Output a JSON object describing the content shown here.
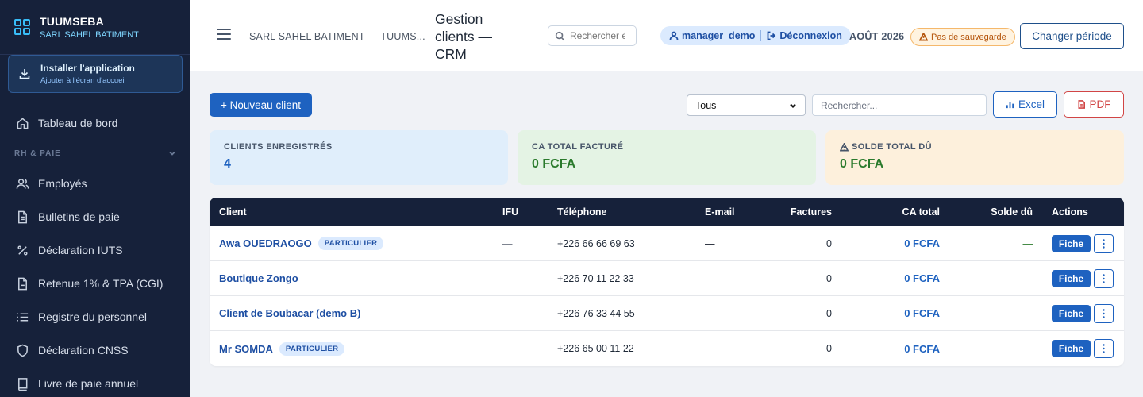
{
  "brand": {
    "name": "TUUMSEBA",
    "company": "SARL SAHEL BATIMENT"
  },
  "install": {
    "title": "Installer l'application",
    "subtitle": "Ajouter à l'écran d'accueil"
  },
  "sidebar": {
    "dashboard": "Tableau de bord",
    "section": "RH & PAIE",
    "items": [
      {
        "label": "Employés",
        "icon": "users-icon"
      },
      {
        "label": "Bulletins de paie",
        "icon": "document-icon"
      },
      {
        "label": "Déclaration IUTS",
        "icon": "percent-icon"
      },
      {
        "label": "Retenue 1% & TPA (CGI)",
        "icon": "file-icon"
      },
      {
        "label": "Registre du personnel",
        "icon": "list-icon"
      },
      {
        "label": "Déclaration CNSS",
        "icon": "shield-icon"
      },
      {
        "label": "Livre de paie annuel",
        "icon": "book-icon"
      }
    ]
  },
  "header": {
    "company": "SARL SAHEL BATIMENT — TUUMS...",
    "title": "Gestion clients — CRM",
    "search_placeholder": "Rechercher é",
    "user": "manager_demo",
    "logout": "Déconnexion",
    "period": "AOÛT 2026",
    "no_save": "Pas de sauvegarde",
    "change_period": "Changer période"
  },
  "toolbar": {
    "new_client": "+ Nouveau client",
    "filter_value": "Tous",
    "search_placeholder": "Rechercher...",
    "excel": "Excel",
    "pdf": "PDF"
  },
  "stats": {
    "clients": {
      "label": "CLIENTS ENREGISTRÉS",
      "value": "4"
    },
    "ca": {
      "label": "CA TOTAL FACTURÉ",
      "value": "0 FCFA"
    },
    "solde": {
      "label": "SOLDE TOTAL DÛ",
      "value": "0 FCFA"
    }
  },
  "table": {
    "headers": {
      "client": "Client",
      "ifu": "IFU",
      "tel": "Téléphone",
      "mail": "E-mail",
      "factures": "Factures",
      "ca": "CA total",
      "solde": "Solde dû",
      "actions": "Actions"
    },
    "fiche_label": "Fiche",
    "rows": [
      {
        "name": "Awa OUEDRAOGO",
        "badge": "PARTICULIER",
        "ifu": "—",
        "tel": "+226 66 66 69 63",
        "mail": "—",
        "factures": "0",
        "ca": "0 FCFA",
        "solde": "—"
      },
      {
        "name": "Boutique Zongo",
        "badge": "",
        "ifu": "—",
        "tel": "+226 70 11 22 33",
        "mail": "—",
        "factures": "0",
        "ca": "0 FCFA",
        "solde": "—"
      },
      {
        "name": "Client de Boubacar (demo B)",
        "badge": "",
        "ifu": "—",
        "tel": "+226 76 33 44 55",
        "mail": "—",
        "factures": "0",
        "ca": "0 FCFA",
        "solde": "—"
      },
      {
        "name": "Mr SOMDA",
        "badge": "PARTICULIER",
        "ifu": "—",
        "tel": "+226 65 00 11 22",
        "mail": "—",
        "factures": "0",
        "ca": "0 FCFA",
        "solde": "—"
      }
    ]
  },
  "colors": {
    "sidebar_bg": "#16213a",
    "accent": "#1e62c0",
    "success": "#2a7a2c",
    "danger": "#d14545",
    "warning": "#b45309"
  }
}
